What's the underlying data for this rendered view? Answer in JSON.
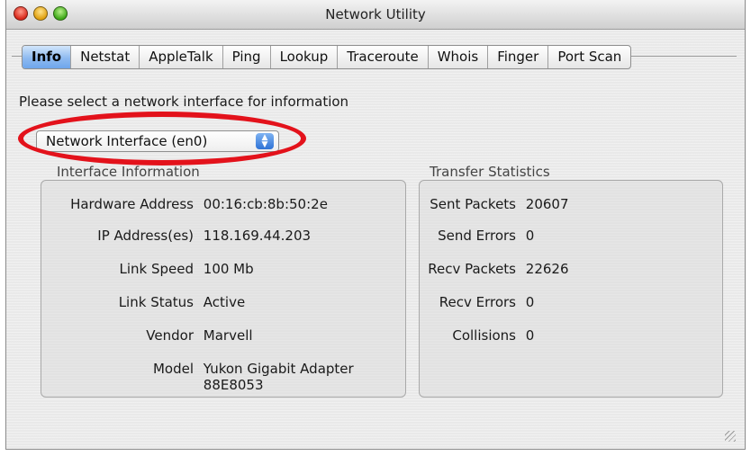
{
  "window": {
    "title": "Network Utility"
  },
  "tabs": [
    {
      "label": "Info",
      "active": true
    },
    {
      "label": "Netstat",
      "active": false
    },
    {
      "label": "AppleTalk",
      "active": false
    },
    {
      "label": "Ping",
      "active": false
    },
    {
      "label": "Lookup",
      "active": false
    },
    {
      "label": "Traceroute",
      "active": false
    },
    {
      "label": "Whois",
      "active": false
    },
    {
      "label": "Finger",
      "active": false
    },
    {
      "label": "Port Scan",
      "active": false
    }
  ],
  "info": {
    "prompt": "Please select a network interface for information",
    "interface_select": {
      "value": "Network Interface (en0)"
    },
    "interface_information": {
      "title": "Interface Information",
      "rows": [
        {
          "label": "Hardware Address",
          "value": "00:16:cb:8b:50:2e"
        },
        {
          "label": "IP Address(es)",
          "value": "118.169.44.203"
        },
        {
          "label": "Link Speed",
          "value": "100 Mb"
        },
        {
          "label": "Link Status",
          "value": "Active"
        },
        {
          "label": "Vendor",
          "value": "Marvell"
        },
        {
          "label": "Model",
          "value": "Yukon Gigabit Adapter",
          "value2": "88E8053"
        }
      ]
    },
    "transfer_statistics": {
      "title": "Transfer Statistics",
      "rows": [
        {
          "label": "Sent Packets",
          "value": "20607"
        },
        {
          "label": "Send Errors",
          "value": "0"
        },
        {
          "label": "Recv Packets",
          "value": "22626"
        },
        {
          "label": "Recv Errors",
          "value": "0"
        },
        {
          "label": "Collisions",
          "value": "0"
        }
      ]
    }
  },
  "annotation": {
    "color": "#e3121b"
  },
  "accent": {
    "tab_active": "#6ea6ec",
    "close": "#d8281a",
    "minimize": "#e0a010",
    "zoom": "#3ea818"
  }
}
